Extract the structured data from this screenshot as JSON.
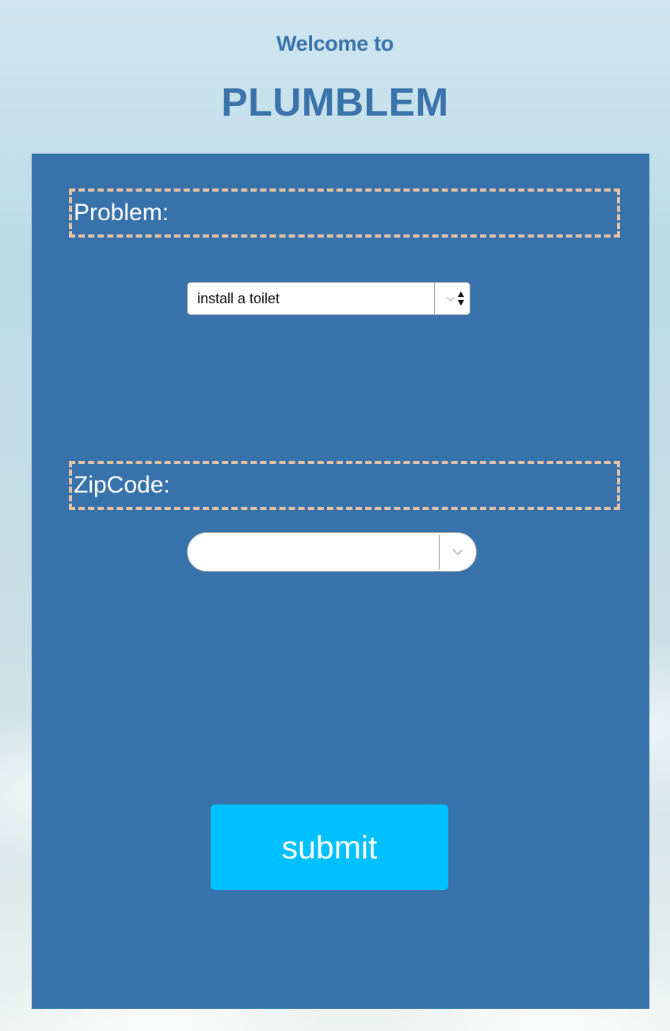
{
  "header": {
    "welcome": "Welcome to",
    "title": "PLUMBLEM"
  },
  "form": {
    "problem_label": "Problem:",
    "problem_select": {
      "selected": "install a toilet"
    },
    "zip_label": "ZipCode:",
    "zip_select": {
      "selected": ""
    },
    "submit_label": "submit"
  },
  "colors": {
    "panel": "#3872aa",
    "title": "#3a72aa",
    "label_border": "#e3c2a6",
    "submit": "#00c0fe"
  },
  "icons": {
    "problem_select": [
      "chevron-down-icon",
      "up-down-arrows-icon"
    ],
    "zip_select": [
      "chevron-down-icon"
    ]
  }
}
